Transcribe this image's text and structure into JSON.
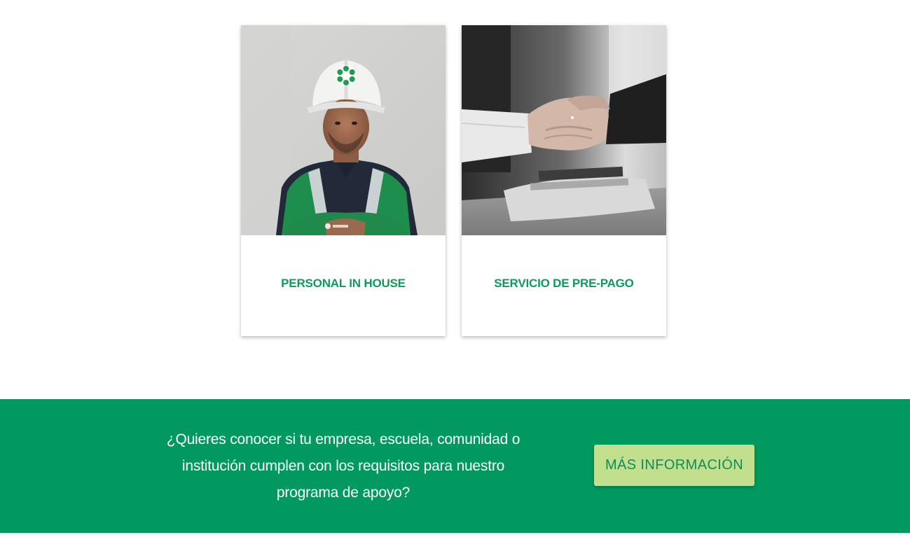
{
  "cards": [
    {
      "title": "PERSONAL IN HOUSE",
      "image": "worker-with-helmet-photo"
    },
    {
      "title": "SERVICIO DE PRE-PAGO",
      "image": "handshake-photo"
    }
  ],
  "cta": {
    "text": "¿Quieres conocer si tu empresa, escuela, comunidad o institución cumplen con los requisitos para nuestro programa de apoyo?",
    "button_label": "MÁS INFORMACIÓN"
  },
  "colors": {
    "brand_green": "#019960",
    "title_green": "#0e9a5c",
    "button_bg": "#c2df8e",
    "button_text": "#0e8d58"
  }
}
